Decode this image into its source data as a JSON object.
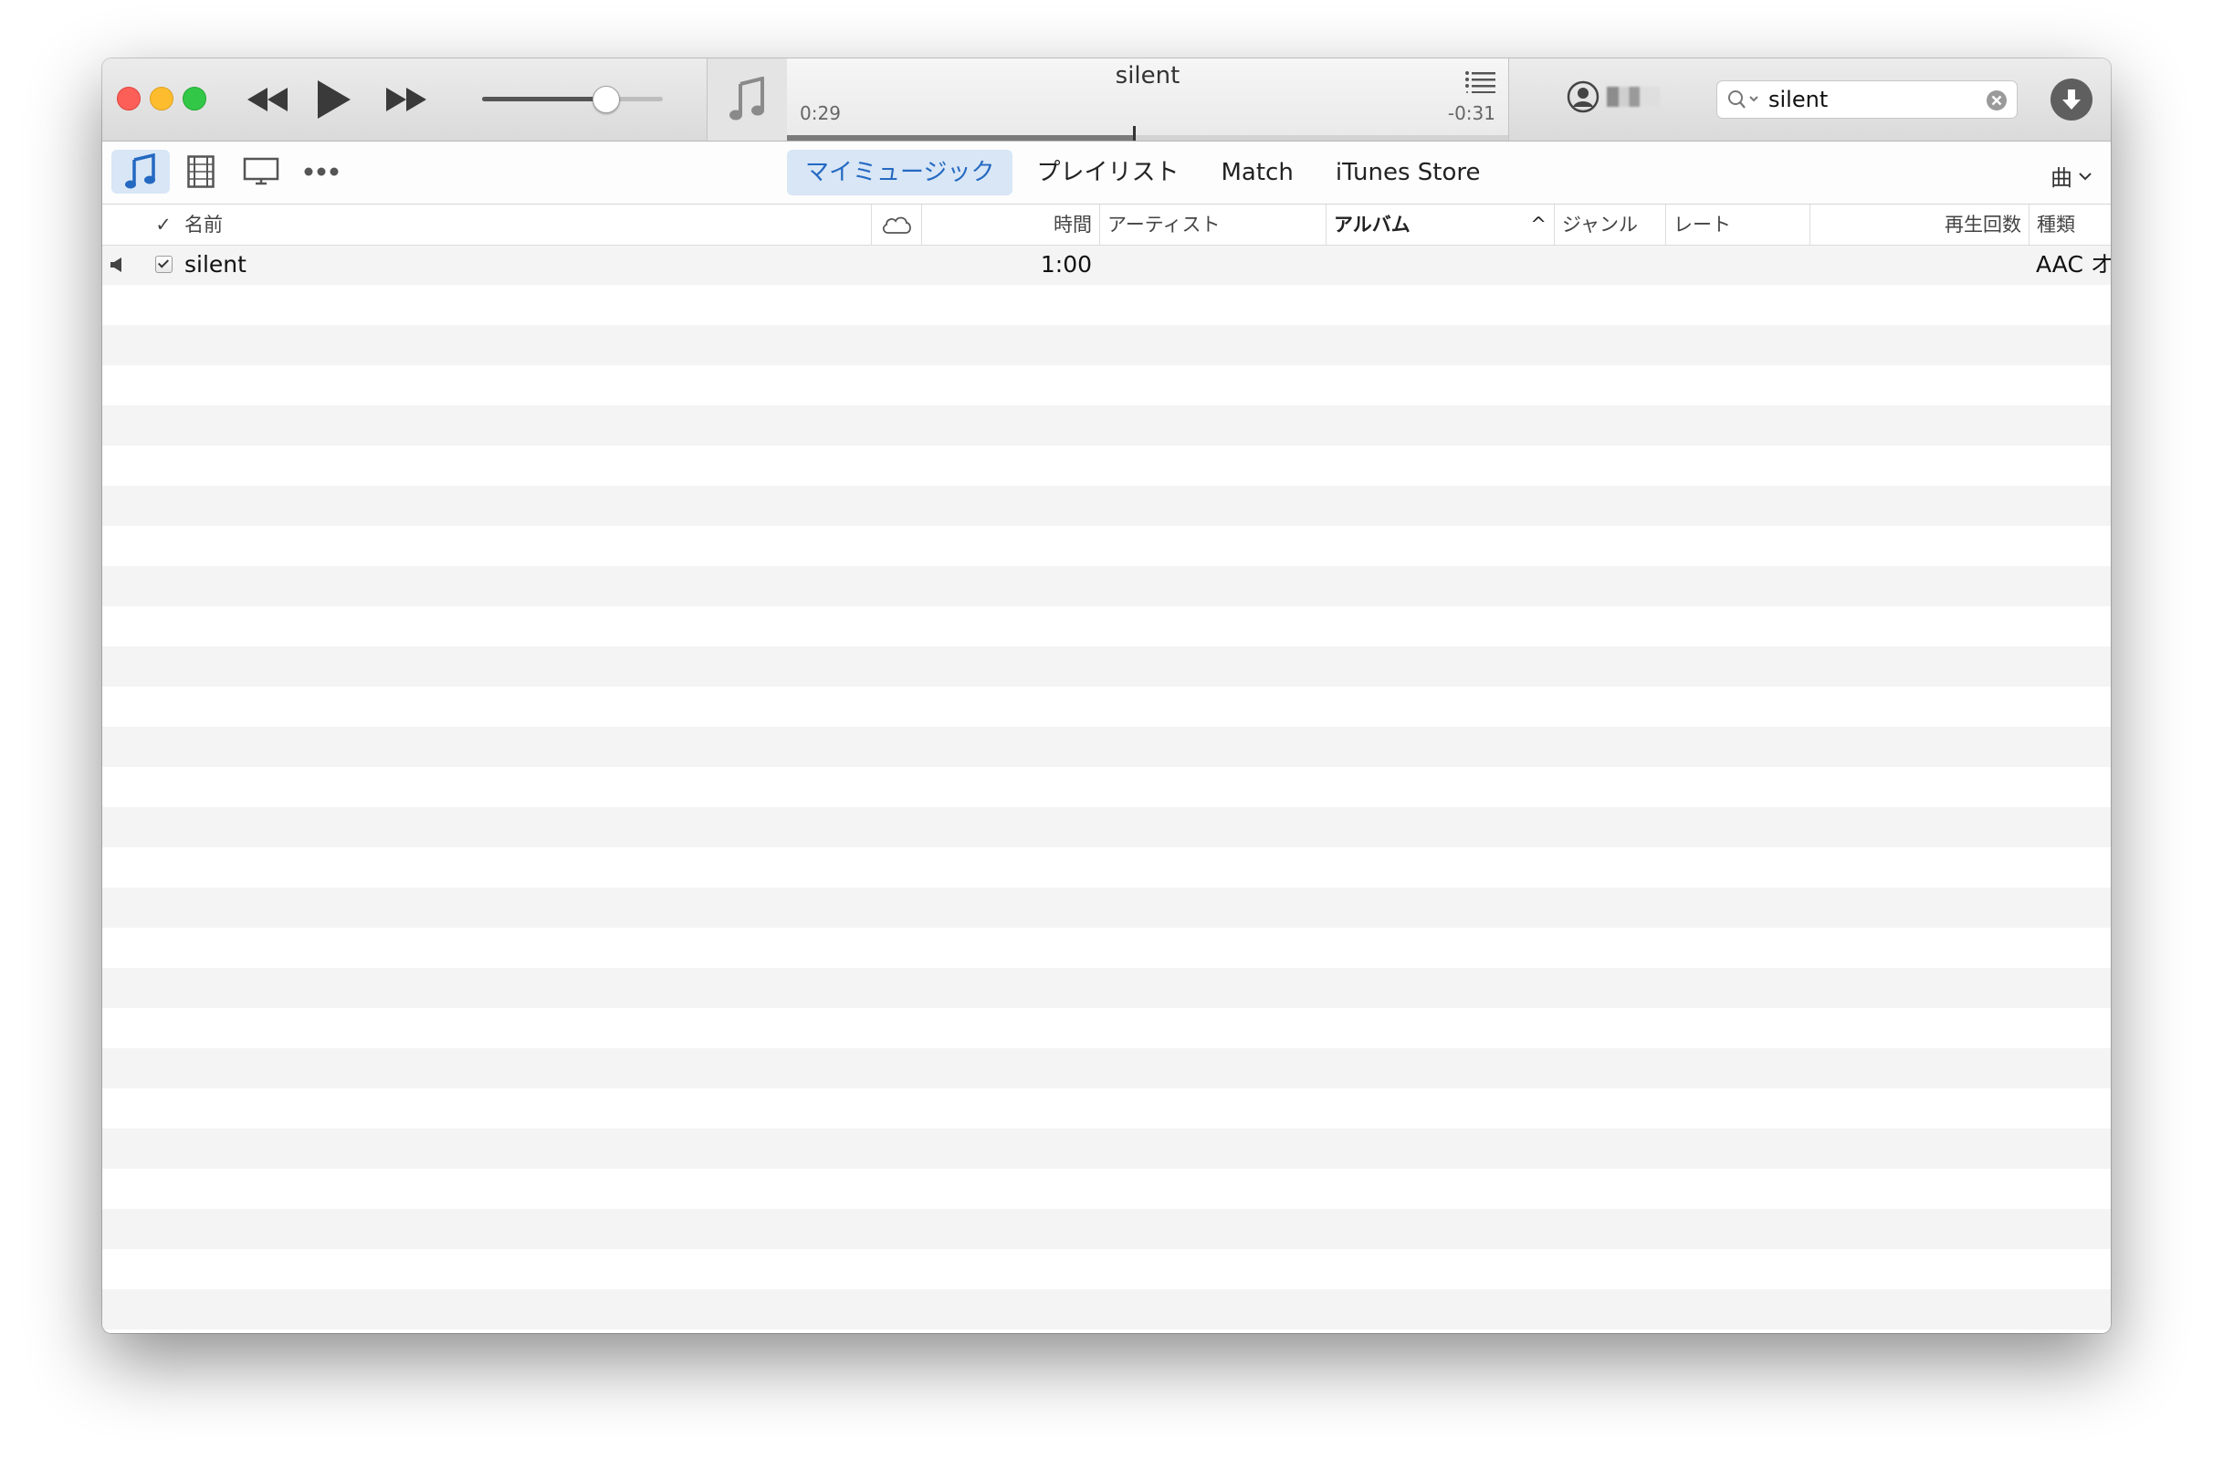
{
  "player": {
    "now_playing_title": "silent",
    "elapsed": "0:29",
    "remaining": "-0:31",
    "progress": 0.48,
    "volume": 0.68
  },
  "search": {
    "value": "silent"
  },
  "nav": {
    "tabs": [
      {
        "label": "マイミュージック",
        "active": true
      },
      {
        "label": "プレイリスト",
        "active": false
      },
      {
        "label": "Match",
        "active": false
      },
      {
        "label": "iTunes Store",
        "active": false
      }
    ],
    "view_menu": "曲"
  },
  "table": {
    "columns": {
      "check": "✓",
      "name": "名前",
      "time": "時間",
      "artist": "アーティスト",
      "album": "アルバム",
      "album_sort_indicator": "^",
      "genre": "ジャンル",
      "rating": "レート",
      "plays": "再生回数",
      "kind": "種類"
    },
    "rows": [
      {
        "name": "silent",
        "time": "1:00",
        "artist": "",
        "album": "",
        "genre": "",
        "rating": "",
        "plays": "",
        "kind": "AAC オーディ…",
        "checked": true,
        "playing": true
      }
    ]
  },
  "colors": {
    "accent": "#2469c1",
    "accent_bg": "#d8e6f6",
    "close": "#fc5f57",
    "minimize": "#fdbc2e",
    "maximize": "#33c748"
  }
}
